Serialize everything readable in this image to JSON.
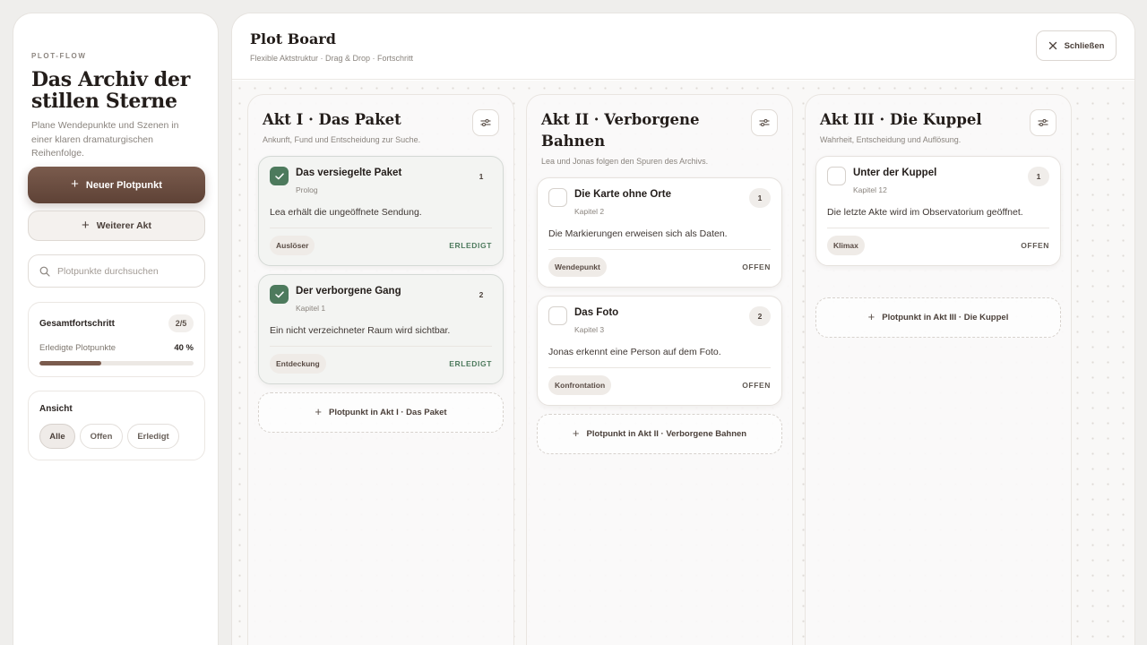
{
  "sidebar": {
    "eyebrow": "PLOT-FLOW",
    "title": "Das Archiv der stillen Sterne",
    "description": "Plane Wendepunkte und Szenen in einer klaren dramaturgischen Reihenfolge.",
    "new_button": "Neuer Plotpunkt",
    "act_button": "Weiterer Akt",
    "search_placeholder": "Plotpunkte durchsuchen",
    "progress": {
      "label": "Gesamtfortschritt",
      "badge": "2/5",
      "sub_label": "Erledigte Plotpunkte",
      "percent_label": "40 %",
      "percent_value": 0.4
    },
    "view": {
      "label": "Ansicht",
      "options": [
        "Alle",
        "Offen",
        "Erledigt"
      ],
      "selected": "Alle"
    }
  },
  "board": {
    "title": "Plot Board",
    "subtitle": "Flexible Aktstruktur · Drag & Drop · Fortschritt",
    "close_label": "Schließen"
  },
  "columns": [
    {
      "title": "Akt I · Das Paket",
      "subtitle": "Ankunft, Fund und Entscheidung zur Suche.",
      "add_label": "Plotpunkt in Akt I · Das Paket",
      "cards": [
        {
          "title": "Das versiegelte Paket",
          "chapter": "Prolog",
          "number": "1",
          "desc": "Lea erhält die ungeöffnete Sendung.",
          "tag": "Auslöser",
          "status": "ERLEDIGT",
          "done": true
        },
        {
          "title": "Der verborgene Gang",
          "chapter": "Kapitel 1",
          "number": "2",
          "desc": "Ein nicht verzeichneter Raum wird sichtbar.",
          "tag": "Entdeckung",
          "status": "ERLEDIGT",
          "done": true
        }
      ]
    },
    {
      "title": "Akt II · Verborgene Bahnen",
      "subtitle": "Lea und Jonas folgen den Spuren des Archivs.",
      "add_label": "Plotpunkt in Akt II · Verborgene Bahnen",
      "cards": [
        {
          "title": "Die Karte ohne Orte",
          "chapter": "Kapitel 2",
          "number": "1",
          "desc": "Die Markierungen erweisen sich als Daten.",
          "tag": "Wendepunkt",
          "status": "OFFEN",
          "done": false
        },
        {
          "title": "Das Foto",
          "chapter": "Kapitel 3",
          "number": "2",
          "desc": "Jonas erkennt eine Person auf dem Foto.",
          "tag": "Konfrontation",
          "status": "OFFEN",
          "done": false
        }
      ]
    },
    {
      "title": "Akt III · Die Kuppel",
      "subtitle": "Wahrheit, Entscheidung und Auflösung.",
      "add_label": "Plotpunkt in Akt III · Die Kuppel",
      "cards": [
        {
          "title": "Unter der Kuppel",
          "chapter": "Kapitel 12",
          "number": "1",
          "desc": "Die letzte Akte wird im Observatorium geöffnet.",
          "tag": "Klimax",
          "status": "OFFEN",
          "done": false
        }
      ]
    }
  ],
  "icons": {
    "plus": "plus-icon",
    "search": "search-icon",
    "close": "close-icon",
    "settings": "sliders-icon",
    "check": "check-icon"
  },
  "colors": {
    "accent": "#6b4d40",
    "done_green": "#4d7a5d",
    "background": "#efeeec"
  }
}
